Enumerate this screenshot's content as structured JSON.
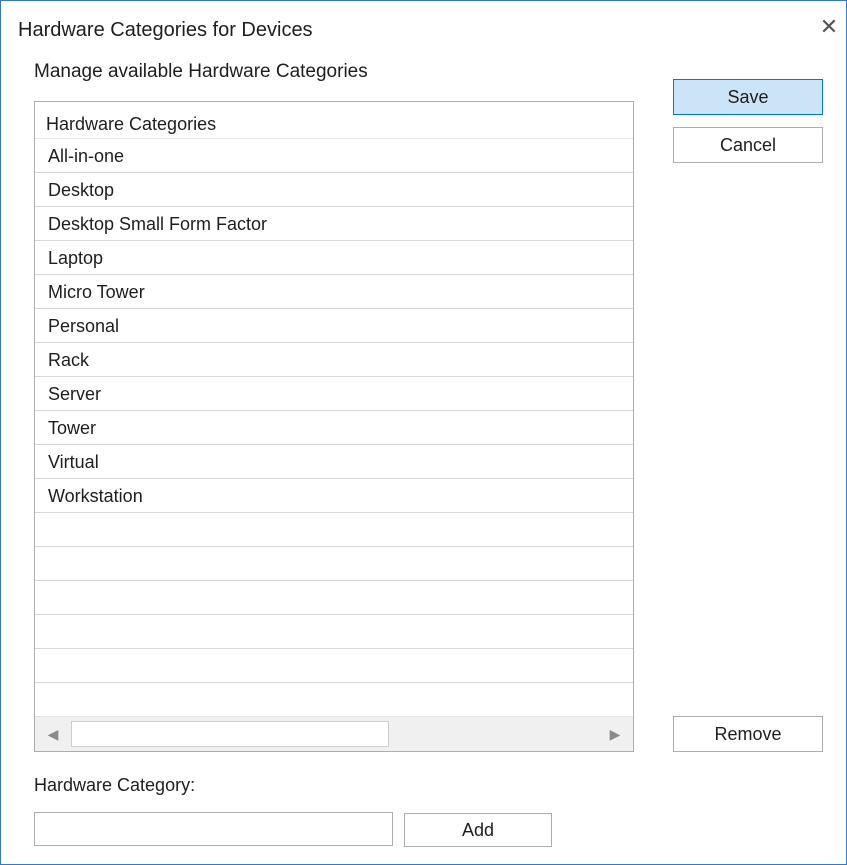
{
  "window": {
    "title": "Hardware Categories for Devices",
    "close_glyph": "✕",
    "accent_color": "#2b7bd3"
  },
  "main": {
    "subtitle": "Manage available Hardware Categories",
    "list": {
      "column_header": "Hardware Categories",
      "items": [
        "All-in-one",
        "Desktop",
        "Desktop Small Form Factor",
        "Laptop",
        "Micro Tower",
        "Personal",
        "Rack",
        "Server",
        "Tower",
        "Virtual",
        "Workstation",
        "",
        "",
        "",
        "",
        "",
        ""
      ],
      "scroll_left_glyph": "◀",
      "scroll_right_glyph": "▶"
    },
    "field": {
      "label": "Hardware Category:",
      "value": "",
      "placeholder": ""
    }
  },
  "buttons": {
    "save": "Save",
    "cancel": "Cancel",
    "remove": "Remove",
    "add": "Add"
  },
  "icons": {
    "close": "close-icon",
    "scroll_left": "arrow-left-icon",
    "scroll_right": "arrow-right-icon"
  }
}
